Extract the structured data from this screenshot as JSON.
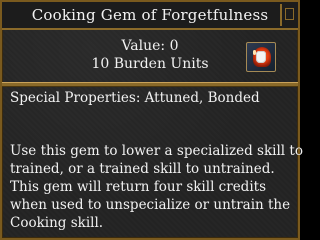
{
  "window": {
    "title": "Cooking Gem of Forgetfulness"
  },
  "item": {
    "value_text": "Value: 0",
    "burden_text": "10 Burden Units",
    "icon": "cooking-gem-icon"
  },
  "properties": {
    "special_text": "Special Properties: Attuned, Bonded"
  },
  "description": {
    "lines": [
      "Use this gem to lower a specialized skill to",
      "trained, or a trained skill to untrained.",
      "This gem will return four skill credits",
      "when used to unspecialize or untrain the",
      "Cooking skill."
    ]
  },
  "colors": {
    "panel_bg": "#262626",
    "border_gold": "#8a6a2a",
    "text": "#f2f2f2"
  }
}
